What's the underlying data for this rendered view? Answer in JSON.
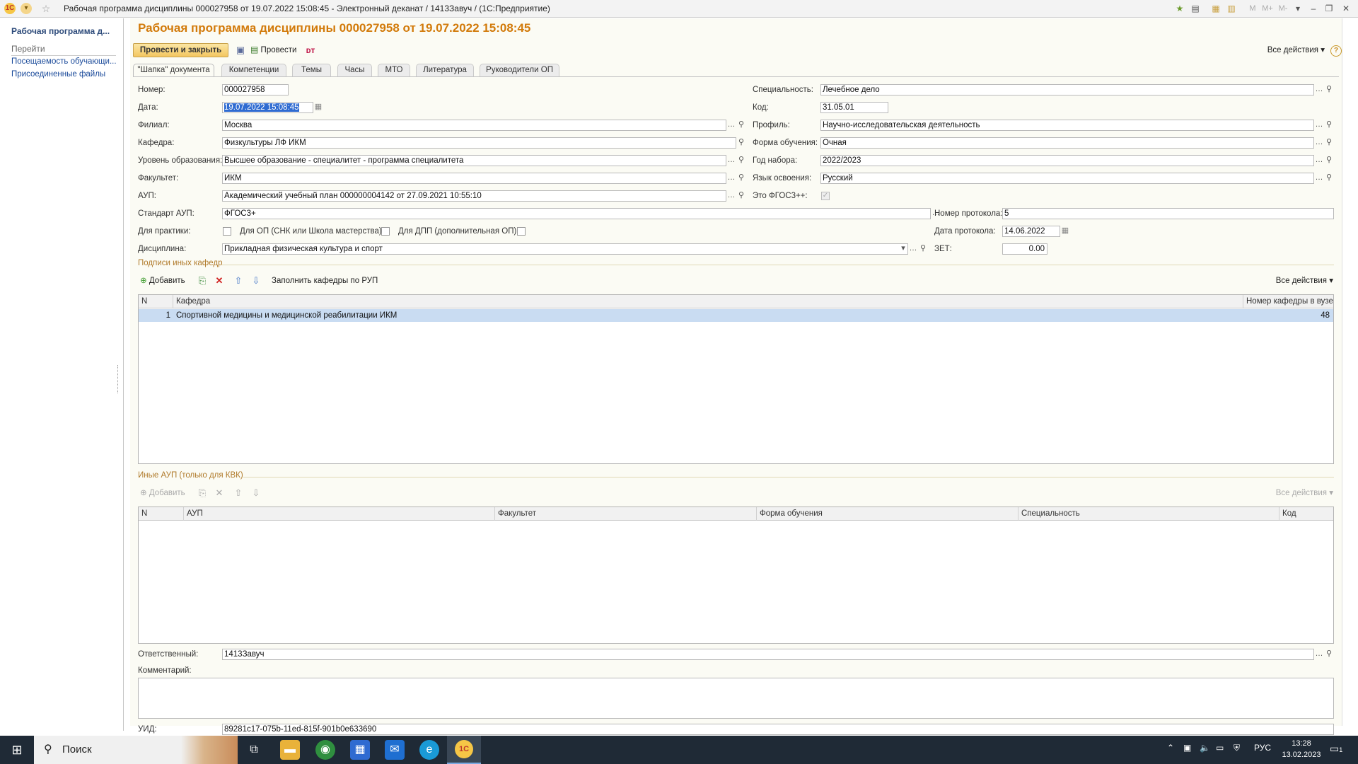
{
  "window": {
    "title": "Рабочая программа дисциплины 000027958 от 19.07.2022 15:08:45 - Электронный деканат / 1413Завуч /  (1С:Предприятие)",
    "right_letters": [
      "M",
      "M+",
      "M-"
    ]
  },
  "sidebar": {
    "title": "Рабочая программа д...",
    "section": "Перейти",
    "links": [
      "Посещаемость обучающи...",
      "Присоединенные файлы"
    ]
  },
  "form": {
    "title": "Рабочая программа дисциплины 000027958 от 19.07.2022 15:08:45",
    "toolbar": {
      "post_close": "Провести и закрыть",
      "post": "Провести",
      "all_actions": "Все действия",
      "help": "?"
    },
    "tabs": [
      "\"Шапка\" документа",
      "Компетенции",
      "Темы",
      "Часы",
      "МТО",
      "Литература",
      "Руководители ОП"
    ],
    "fields": {
      "number_label": "Номер:",
      "number": "000027958",
      "date_label": "Дата:",
      "date": "19.07.2022 15:08:45",
      "branch_label": "Филиал:",
      "branch": "Москва",
      "dept_label": "Кафедра:",
      "dept": "Физкультуры ЛФ ИКМ",
      "edu_level_label": "Уровень образования:",
      "edu_level": "Высшее образование - специалитет - программа специалитета",
      "faculty_label": "Факультет:",
      "faculty": "ИКМ",
      "aup_label": "АУП:",
      "aup": "Академический учебный план 000000004142 от 27.09.2021 10:55:10",
      "aup_standard_label": "Стандарт АУП:",
      "aup_standard": "ФГОС3+",
      "practice_label": "Для практики:",
      "op_label": "Для ОП (СНК или Школа мастерства):",
      "dpp_label": "Для ДПП (дополнительная ОП):",
      "discipline_label": "Дисциплина:",
      "discipline": "Прикладная физическая культура и спорт",
      "speciality_label": "Специальность:",
      "speciality": "Лечебное дело",
      "code_label": "Код:",
      "code": "31.05.01",
      "profile_label": "Профиль:",
      "profile": "Научно-исследовательская деятельность",
      "study_form_label": "Форма обучения:",
      "study_form": "Очная",
      "year_label": "Год набора:",
      "year": "2022/2023",
      "language_label": "Язык освоения:",
      "language": "Русский",
      "fgos_label": "Это ФГОС3++:",
      "protocol_no_label": "Номер протокола:",
      "protocol_no": "5",
      "protocol_date_label": "Дата протокола:",
      "protocol_date": "14.06.2022",
      "zet_label": "ЗЕТ:",
      "zet": "0.00"
    },
    "signatures": {
      "header": "Подписи иных кафедр",
      "add": "Добавить",
      "fill": "Заполнить кафедры по РУП",
      "all_actions": "Все действия",
      "columns": [
        "N",
        "Кафедра",
        "Номер кафедры в вузе"
      ],
      "rows": [
        {
          "n": "1",
          "dept": "Спортивной медицины и медицинской реабилитации ИКМ",
          "num": "48"
        }
      ]
    },
    "other_aup": {
      "header": "Иные АУП (только для КВК)",
      "add": "Добавить",
      "all_actions": "Все действия",
      "columns": [
        "N",
        "АУП",
        "Факультет",
        "Форма обучения",
        "Специальность",
        "Код"
      ]
    },
    "responsible_label": "Ответственный:",
    "responsible": "1413Завуч",
    "comment_label": "Комментарий:",
    "comment": "",
    "uid_label": "УИД:",
    "uid": "89281c17-075b-11ed-815f-901b0e633690"
  },
  "taskbar": {
    "search": "Поиск",
    "lang": "РУС",
    "time": "13:28",
    "date": "13.02.2023",
    "notif_count": "1"
  },
  "colors": {
    "title_orange": "#d27a0a",
    "link_blue": "#1a4a9a",
    "selected_row": "#c9dcf2",
    "taskbar": "#1f2a36"
  }
}
